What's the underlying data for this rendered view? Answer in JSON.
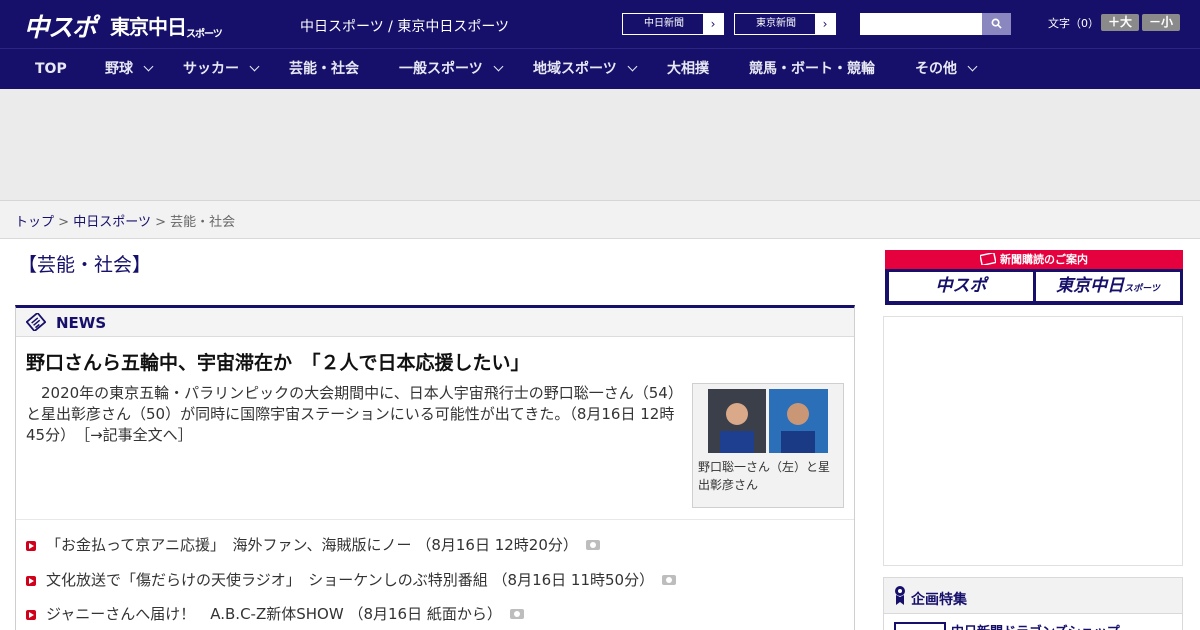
{
  "header": {
    "logo_chuspo": "中スポ",
    "logo_tokyo": "東京中日",
    "logo_tokyo_suffix": "スポーツ",
    "site_names": "中日スポーツ / 東京中日スポーツ",
    "link_chunichi": "中日新聞",
    "link_tokyo": "東京新聞",
    "search_placeholder": "",
    "font_label": "文字（0）",
    "font_larger": "＋大",
    "font_smaller": "－小"
  },
  "nav": {
    "items": [
      {
        "label": "TOP",
        "dropdown": false
      },
      {
        "label": "野球",
        "dropdown": true
      },
      {
        "label": "サッカー",
        "dropdown": true
      },
      {
        "label": "芸能・社会",
        "dropdown": false
      },
      {
        "label": "一般スポーツ",
        "dropdown": true
      },
      {
        "label": "地域スポーツ",
        "dropdown": true
      },
      {
        "label": "大相撲",
        "dropdown": false
      },
      {
        "label": "競馬・ボート・競輪",
        "dropdown": false
      },
      {
        "label": "その他",
        "dropdown": true
      }
    ]
  },
  "breadcrumb": {
    "home": "トップ",
    "section": "中日スポーツ",
    "current": "芸能・社会",
    "sep": ">"
  },
  "page_title": "【芸能・社会】",
  "news": {
    "title": "NEWS",
    "headline": "野口さんら五輪中、宇宙滞在か　「２人で日本応援したい」",
    "lead": "　2020年の東京五輪・パラリンピックの大会期間中に、日本人宇宙飛行士の野口聡一さん（54）と星出彰彦さん（50）が同時に国際宇宙ステーションにいる可能性が出てきた。（8月16日 12時45分）",
    "more_link": "［→記事全文へ］",
    "photo_caption": "野口聡一さん（左）と星出彰彦さん",
    "items": [
      {
        "text": "「お金払って京アニ応援」　海外ファン、海賊版にノー （8月16日 12時20分）",
        "photo": true
      },
      {
        "text": "文化放送で「傷だらけの天使ラジオ」　ショーケンしのぶ特別番組 （8月16日 11時50分）",
        "photo": true
      },
      {
        "text": "ジャニーさんへ届け！　A.B.C-Z新体SHOW （8月16日 紙面から）",
        "photo": true
      }
    ]
  },
  "sidebar": {
    "subscribe_title": "新聞購読のご案内",
    "subscribe_chuspo": "中スポ",
    "subscribe_tokyo": "東京中日",
    "subscribe_tokyo_suffix": "スポーツ",
    "feature_title": "企画特集",
    "feature_link": "中日新聞ドラゴンズショップ"
  },
  "colors": {
    "brand_navy": "#16106b",
    "accent_red": "#e5003e",
    "bullet_red": "#d0021b"
  }
}
